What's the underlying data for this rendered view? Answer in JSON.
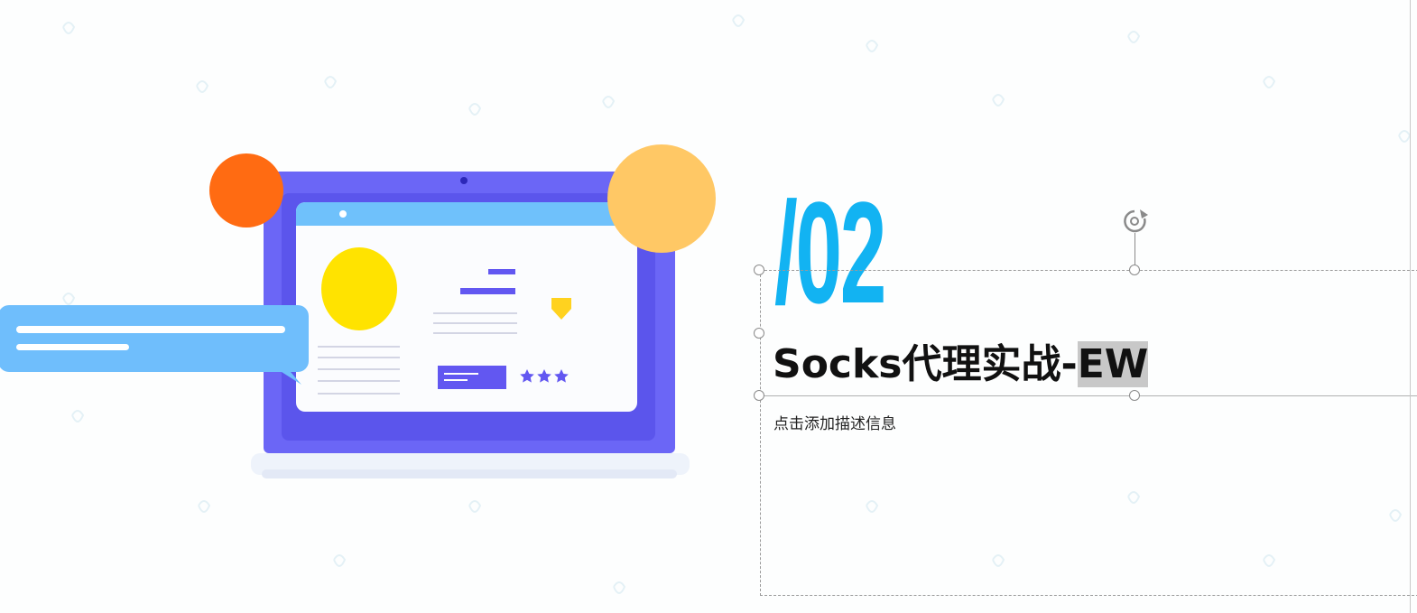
{
  "slide": {
    "section_number": "/02",
    "title_main": "Socks代理实战-",
    "title_highlight": "EW",
    "subtitle": "点击添加描述信息"
  },
  "colors": {
    "number": "#12b3f2",
    "laptop_frame": "#6b66f6",
    "screen_bar": "#6fc1fb",
    "orange_circle": "#ff6b12",
    "yellow_circle": "#ffc865",
    "yellow_disc": "#ffe300",
    "speech_bubble": "#6fbefc"
  },
  "icons": [
    "rotate-handle-icon",
    "star-icon"
  ]
}
